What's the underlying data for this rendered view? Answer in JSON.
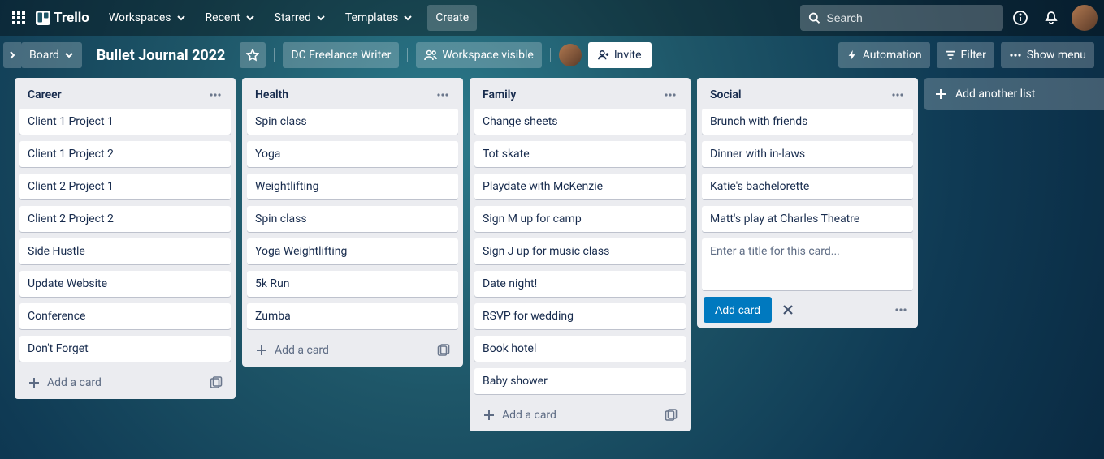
{
  "nav": {
    "logo": "Trello",
    "menus": [
      "Workspaces",
      "Recent",
      "Starred",
      "Templates"
    ],
    "create": "Create",
    "search_placeholder": "Search"
  },
  "board": {
    "board_btn": "Board",
    "title": "Bullet Journal 2022",
    "workspace_label": "DC Freelance Writer",
    "visibility_label": "Workspace visible",
    "invite": "Invite",
    "automation": "Automation",
    "filter": "Filter",
    "show_menu": "Show menu"
  },
  "lists": [
    {
      "title": "Career",
      "cards": [
        "Client 1 Project 1",
        "Client 1 Project 2",
        "Client 2 Project 1",
        "Client 2 Project 2",
        "Side Hustle",
        "Update Website",
        "Conference",
        "Don't Forget"
      ],
      "composing": false
    },
    {
      "title": "Health",
      "cards": [
        "Spin class",
        "Yoga",
        "Weightlifting",
        "Spin class",
        "Yoga Weightlifting",
        "5k Run",
        "Zumba"
      ],
      "composing": false
    },
    {
      "title": "Family",
      "cards": [
        "Change sheets",
        "Tot skate",
        "Playdate with McKenzie",
        "Sign M up for camp",
        "Sign J up for music class",
        "Date night!",
        "RSVP for wedding",
        "Book hotel",
        "Baby shower"
      ],
      "composing": false
    },
    {
      "title": "Social",
      "cards": [
        "Brunch with friends",
        "Dinner with in-laws",
        "Katie's bachelorette",
        "Matt's play at Charles Theatre"
      ],
      "composing": true
    }
  ],
  "labels": {
    "add_a_card": "Add a card",
    "add_card_btn": "Add card",
    "add_another_list": "Add another list",
    "card_title_placeholder": "Enter a title for this card..."
  }
}
